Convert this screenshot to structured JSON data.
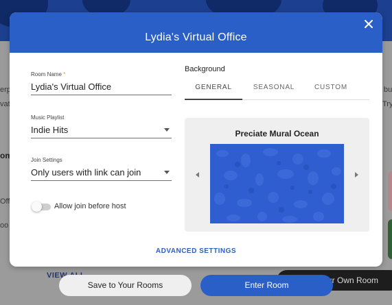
{
  "modal": {
    "title": "Lydia's Virtual Office",
    "close_icon": "close-icon",
    "room_name": {
      "label": "Room Name",
      "required_mark": "*",
      "value": "Lydia's Virtual Office"
    },
    "music_playlist": {
      "label": "Music Playlist",
      "value": "Indie Hits"
    },
    "join_settings": {
      "label": "Join Settings",
      "value": "Only users with link can join"
    },
    "allow_join_toggle": {
      "label": "Allow join before host",
      "on": false
    },
    "background": {
      "label": "Background",
      "tabs": [
        {
          "label": "GENERAL",
          "active": true
        },
        {
          "label": "SEASONAL",
          "active": false
        },
        {
          "label": "CUSTOM",
          "active": false
        }
      ],
      "preview_title": "Preciate Mural Ocean"
    },
    "advanced_settings": "ADVANCED SETTINGS"
  },
  "actions": {
    "save_label": "Save to Your Rooms",
    "enter_label": "Enter Room"
  },
  "background_page": {
    "fragments": [
      "erp",
      "vat",
      "om",
      "Offi",
      "oo",
      "bu",
      "Try"
    ],
    "view_all": "VIEW ALL",
    "own_room": "ur Own Room"
  },
  "colors": {
    "accent": "#2b5fc8",
    "required": "#e59a20",
    "mural": "#2f5ed0"
  }
}
